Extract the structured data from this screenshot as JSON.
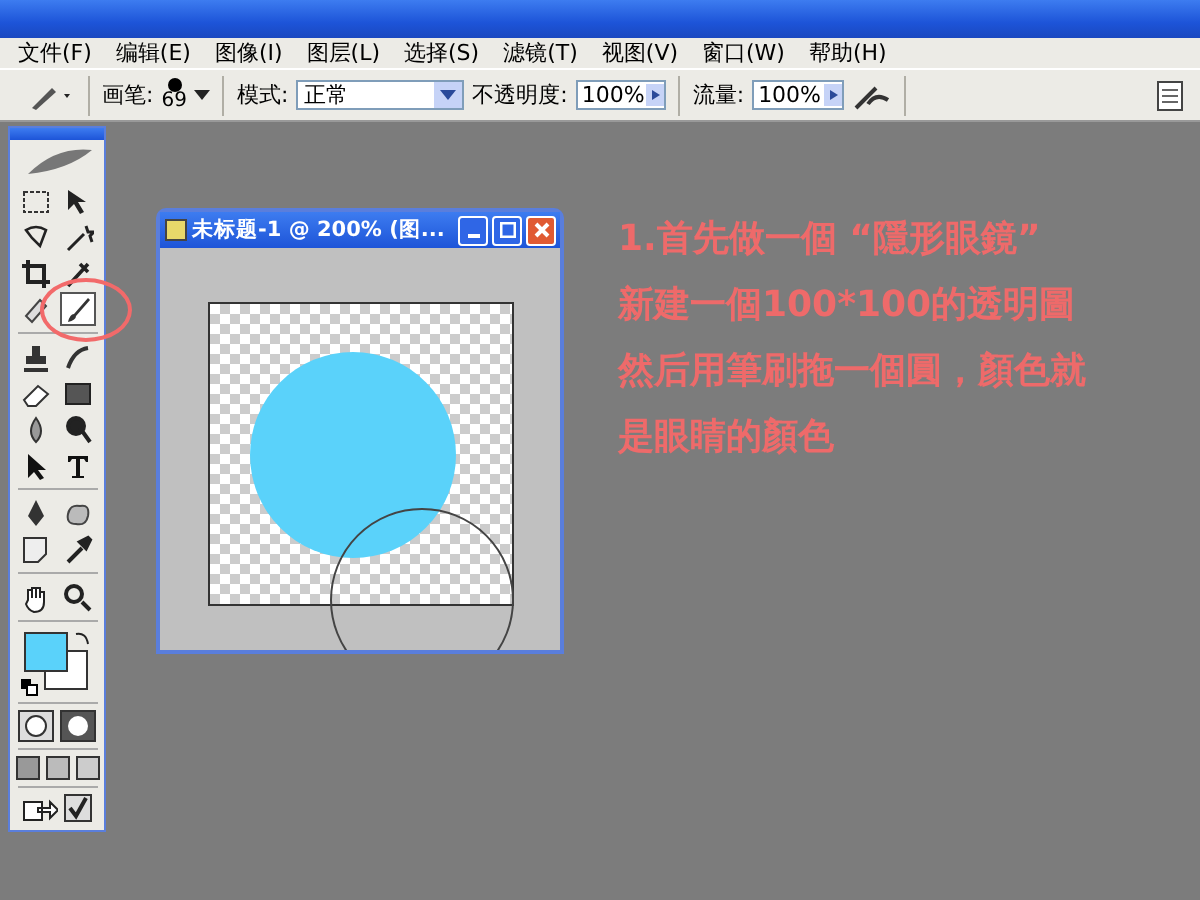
{
  "menu": [
    {
      "label": "文件(F)"
    },
    {
      "label": "编辑(E)"
    },
    {
      "label": "图像(I)"
    },
    {
      "label": "图层(L)"
    },
    {
      "label": "选择(S)"
    },
    {
      "label": "滤镜(T)"
    },
    {
      "label": "视图(V)"
    },
    {
      "label": "窗口(W)"
    },
    {
      "label": "帮助(H)"
    }
  ],
  "options": {
    "brush_label": "画笔:",
    "brush_size": "69",
    "mode_label": "模式:",
    "mode": "正常",
    "opacity_label": "不透明度:",
    "opacity": "100%",
    "flow_label": "流量:",
    "flow": "100%"
  },
  "tools": [
    {
      "kind": "marquee",
      "selected": false
    },
    {
      "kind": "move",
      "selected": false
    },
    {
      "kind": "lasso",
      "selected": false
    },
    {
      "kind": "wand",
      "selected": false
    },
    {
      "kind": "crop",
      "selected": false
    },
    {
      "kind": "slice",
      "selected": false
    },
    {
      "kind": "heal",
      "selected": false
    },
    {
      "kind": "brush",
      "selected": true
    },
    {
      "kind": "stamp",
      "selected": false
    },
    {
      "kind": "history",
      "selected": false
    },
    {
      "kind": "eraser",
      "selected": false
    },
    {
      "kind": "gradient",
      "selected": false
    },
    {
      "kind": "blur",
      "selected": false
    },
    {
      "kind": "dodge",
      "selected": false
    },
    {
      "kind": "path",
      "selected": false
    },
    {
      "kind": "type",
      "selected": false
    },
    {
      "kind": "pen",
      "selected": false
    },
    {
      "kind": "shape",
      "selected": false
    },
    {
      "kind": "notes",
      "selected": false
    },
    {
      "kind": "eyedropper",
      "selected": false
    },
    {
      "kind": "hand",
      "selected": false
    },
    {
      "kind": "zoom",
      "selected": false
    }
  ],
  "document": {
    "title": "未标题-1 @ 200% (图..."
  },
  "annotation": [
    "1.首先做一個 “隱形眼鏡”",
    "新建一個100*100的透明圖",
    "然后用筆刷拖一個圓，顏色就",
    "是眼睛的顏色"
  ]
}
